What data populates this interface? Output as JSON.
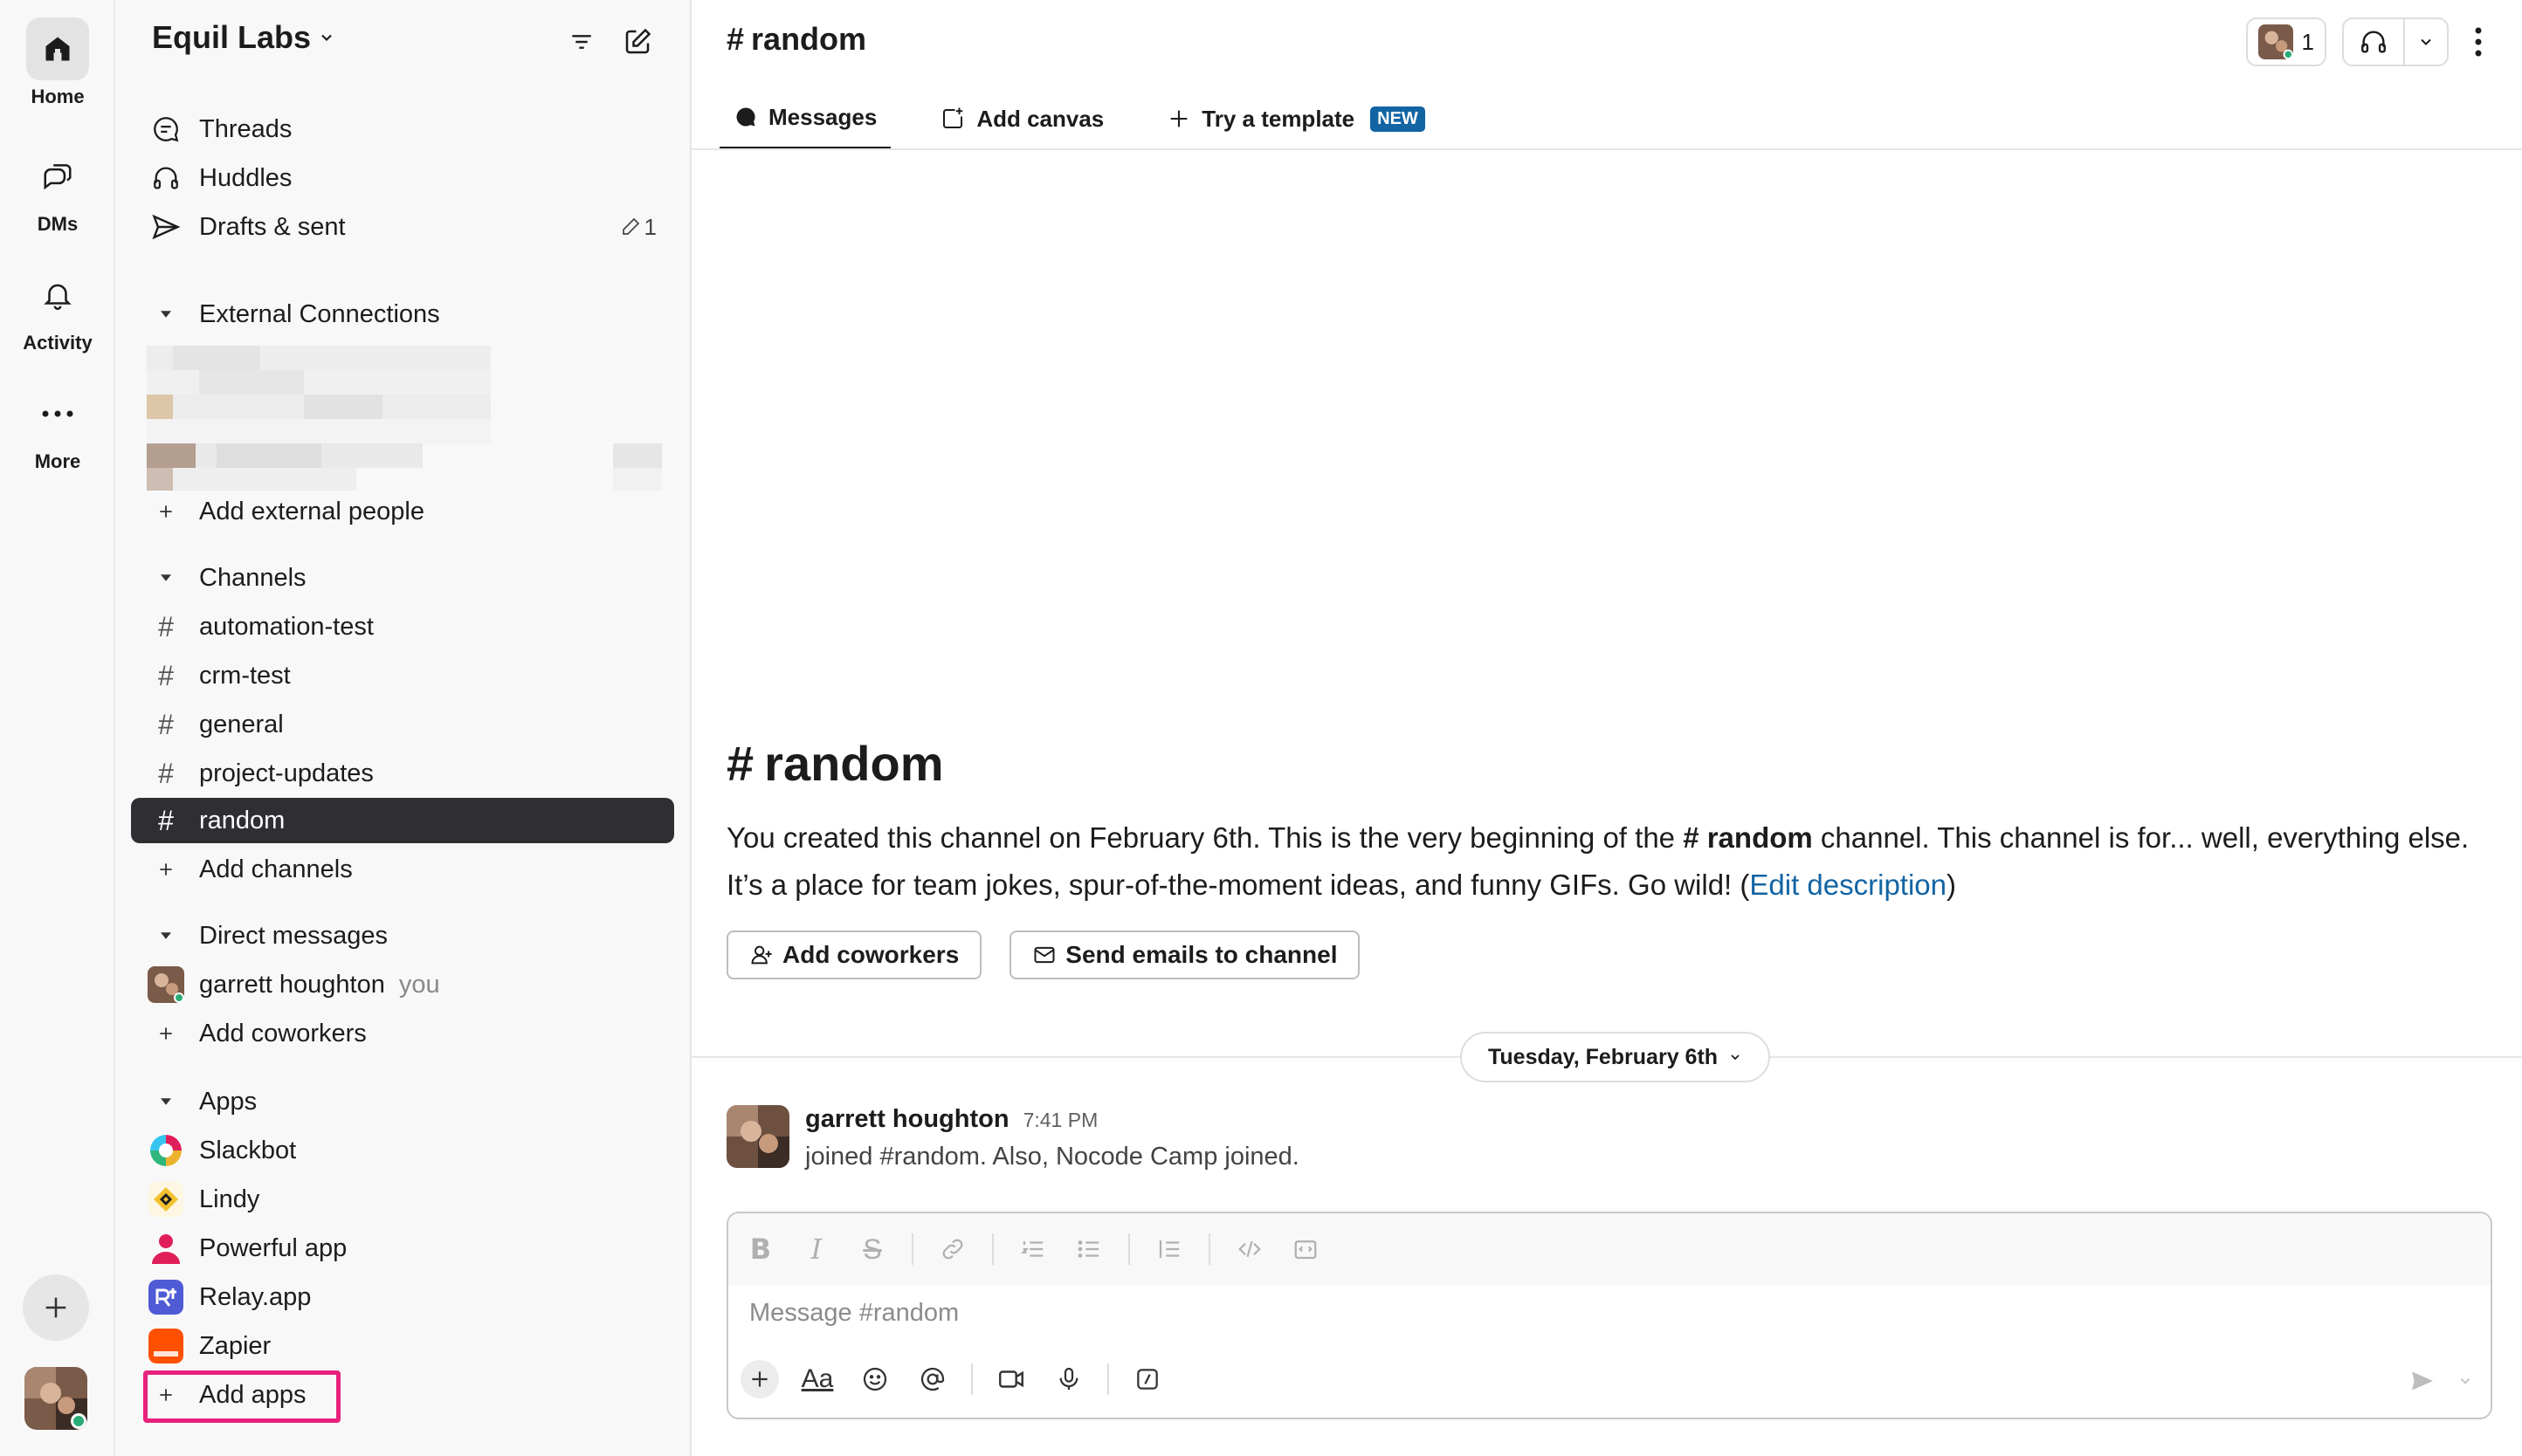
{
  "rail": {
    "items": [
      {
        "label": "Home",
        "icon": "home-icon"
      },
      {
        "label": "DMs",
        "icon": "dms-icon"
      },
      {
        "label": "Activity",
        "icon": "bell-icon"
      },
      {
        "label": "More",
        "icon": "more-icon"
      }
    ]
  },
  "workspace": {
    "name": "Equil Labs"
  },
  "sidebar": {
    "threads": "Threads",
    "huddles": "Huddles",
    "drafts": "Drafts & sent",
    "drafts_count": "1",
    "external_section": "External Connections",
    "add_external": "Add external people",
    "channels_section": "Channels",
    "channels": [
      "automation-test",
      "crm-test",
      "general",
      "project-updates",
      "random"
    ],
    "add_channels": "Add channels",
    "dm_section": "Direct messages",
    "dm_user": "garrett houghton",
    "dm_you": "you",
    "add_coworkers": "Add coworkers",
    "apps_section": "Apps",
    "apps": [
      "Slackbot",
      "Lindy",
      "Powerful app",
      "Relay.app",
      "Zapier"
    ],
    "add_apps": "Add apps"
  },
  "header": {
    "channel": "random",
    "member_count": "1",
    "tabs": {
      "messages": "Messages",
      "canvas": "Add canvas",
      "template": "Try a template",
      "new_badge": "NEW"
    }
  },
  "intro": {
    "title": "random",
    "text_before": "You created this channel on February 6th. This is the very beginning of the ",
    "channel_ref": "random",
    "text_after": " channel. This channel is for... well, everything else. It’s a place for team jokes, spur-of-the-moment ideas, and funny GIFs. Go wild! (",
    "edit_link": "Edit description",
    "text_close": ")",
    "btn_coworkers": "Add coworkers",
    "btn_emails": "Send emails to channel"
  },
  "day_divider": "Tuesday, February 6th",
  "message": {
    "author": "garrett houghton",
    "time": "7:41 PM",
    "body": "joined #random. Also, Nocode Camp joined."
  },
  "composer": {
    "placeholder": "Message #random"
  },
  "colors": {
    "accent_link": "#1264a3",
    "active_row": "#2f2e33",
    "highlight": "#e8227c"
  }
}
